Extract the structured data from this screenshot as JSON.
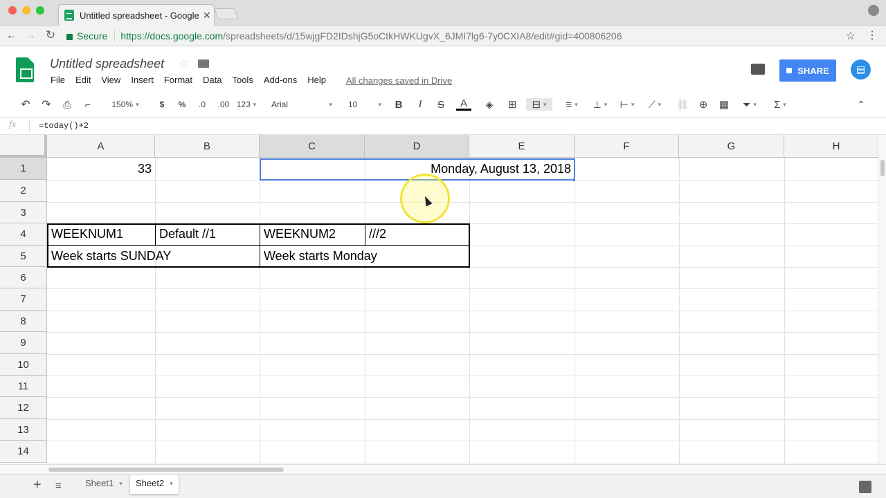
{
  "browser": {
    "tab_title": "Untitled spreadsheet - Google",
    "secure_label": "Secure",
    "url_host": "https://docs.google.com",
    "url_path": "/spreadsheets/d/15wjgFD2IDshjG5oCtkHWKUgvX_6JMI7lg6-7y0CXIA8/edit#gid=400806206"
  },
  "app": {
    "title": "Untitled spreadsheet",
    "menus": [
      "File",
      "Edit",
      "View",
      "Insert",
      "Format",
      "Data",
      "Tools",
      "Add-ons",
      "Help"
    ],
    "saved_status": "All changes saved in Drive",
    "share_label": "SHARE"
  },
  "toolbar": {
    "zoom": "150%",
    "currency": "$",
    "percent": "%",
    "dec_less": ".0",
    "dec_more": ".00",
    "more_formats": "123",
    "font": "Arial",
    "font_size": "10",
    "bold": "B",
    "italic": "I",
    "strike": "S",
    "text_color": "A"
  },
  "formula_bar": {
    "fx_label": "fx",
    "formula": "=today()+2"
  },
  "grid": {
    "columns": [
      "A",
      "B",
      "C",
      "D",
      "E",
      "F",
      "G",
      "H"
    ],
    "rows": [
      "1",
      "2",
      "3",
      "4",
      "5",
      "6",
      "7",
      "8",
      "9",
      "10",
      "11",
      "12",
      "13",
      "14"
    ],
    "selected_column": "D",
    "selected_row": "1",
    "cells": {
      "A1": "33",
      "C1": "Monday, August 13, 2018",
      "A4": "WEEKNUM1",
      "B4": "Default //1",
      "C4": "WEEKNUM2",
      "D4": "///2",
      "A5": "Week starts SUNDAY",
      "C5": "Week starts Monday"
    }
  },
  "sheets": {
    "tabs": [
      "Sheet1",
      "Sheet2"
    ],
    "active": "Sheet2"
  },
  "colors": {
    "accent": "#4285f4",
    "sheets_green": "#0f9d58",
    "selection": "#4a7fd6"
  }
}
